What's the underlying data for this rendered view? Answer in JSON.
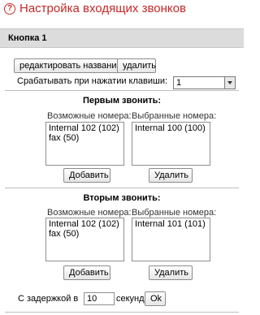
{
  "header": {
    "title": "Настройка входящих звонков",
    "help_icon": "question-icon"
  },
  "section": {
    "title": "Кнопка 1"
  },
  "toolbar": {
    "edit_label": "редактировать название",
    "delete_label": "удалить"
  },
  "trigger": {
    "label": "Срабатывать при нажатии клавиши:",
    "value": "1"
  },
  "first": {
    "heading": "Первым звонить:",
    "possible_label": "Возможные номера:",
    "possible": [
      "Internal 102 (102)",
      "fax (50)"
    ],
    "selected_label": "Выбранные номера:",
    "selected": [
      "Internal 100 (100)"
    ],
    "add_label": "Добавить",
    "remove_label": "Удалить"
  },
  "second": {
    "heading": "Вторым звонить:",
    "possible_label": "Возможные номера:",
    "possible": [
      "Internal 102 (102)",
      "fax (50)"
    ],
    "selected_label": "Выбранные номера:",
    "selected": [
      "Internal 101 (101)"
    ],
    "add_label": "Добавить",
    "remove_label": "Удалить"
  },
  "delay": {
    "prefix": "С задержкой в",
    "value": "10",
    "suffix": "секунд",
    "ok_label": "Ok"
  },
  "colors": {
    "title": "#c62828",
    "bar": "#dcdcdc"
  }
}
